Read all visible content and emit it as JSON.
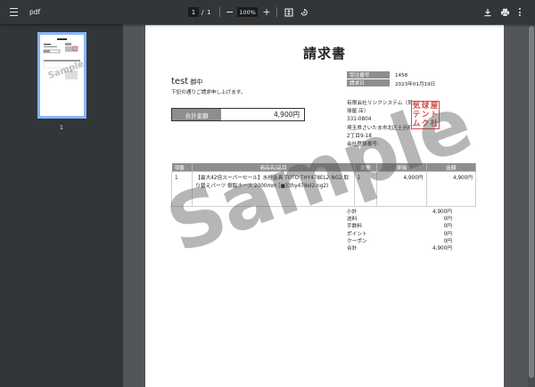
{
  "toolbar": {
    "title": "pdf",
    "current_page": "1",
    "page_separator": "/",
    "total_pages": "1",
    "zoom": "100%",
    "zoom_in": "+"
  },
  "sidebar": {
    "thumbnail_page_number": "1"
  },
  "invoice": {
    "title": "請求書",
    "customer_name": "test",
    "customer_suffix": "御中",
    "note": "下記の通りご請求申し上げます。",
    "total_label": "合計金額",
    "total_value": "4,900円",
    "meta": [
      {
        "label": "受注番号",
        "value": "1458"
      },
      {
        "label": "請求日",
        "value": "2023年01月19日"
      }
    ],
    "company": {
      "name": "有限会社リンクシステム（気球屋 店）",
      "postal": "331-0804",
      "address": "埼玉県さいたま市北区土呂町2丁目9-18",
      "registration": "会社登録番号:"
    },
    "stamp_chars": [
      "気",
      "球",
      "屋",
      "テ",
      "ン",
      "ト",
      "ム",
      "ク",
      "社"
    ],
    "table_headers": [
      "項番",
      "商品名/品目",
      "数量",
      "単価",
      "金額"
    ],
    "rows": [
      {
        "no": "1",
        "name": "【最大42倍スーパーセール】水栓金具 TOTO THY478EL2-NG2 取り替えパーツ 樹脂ホース 2000mm [■](thy478el2-ng2)",
        "qty": "1",
        "unit": "4,900円",
        "amount": "4,900円"
      }
    ],
    "summary": [
      {
        "label": "小計",
        "value": "4,900円"
      },
      {
        "label": "送料",
        "value": "0円"
      },
      {
        "label": "手数料",
        "value": "0円"
      },
      {
        "label": "ポイント",
        "value": "0円"
      },
      {
        "label": "クーポン",
        "value": "0円"
      },
      {
        "label": "合計",
        "value": "4,900円"
      }
    ],
    "watermark": "Sample"
  },
  "colors": {
    "toolbar_bg": "#323639",
    "viewer_bg": "#525659",
    "thumb_border": "#8ab4f8",
    "header_gray": "#8e8e8e",
    "stamp_red": "#d24c4c"
  }
}
